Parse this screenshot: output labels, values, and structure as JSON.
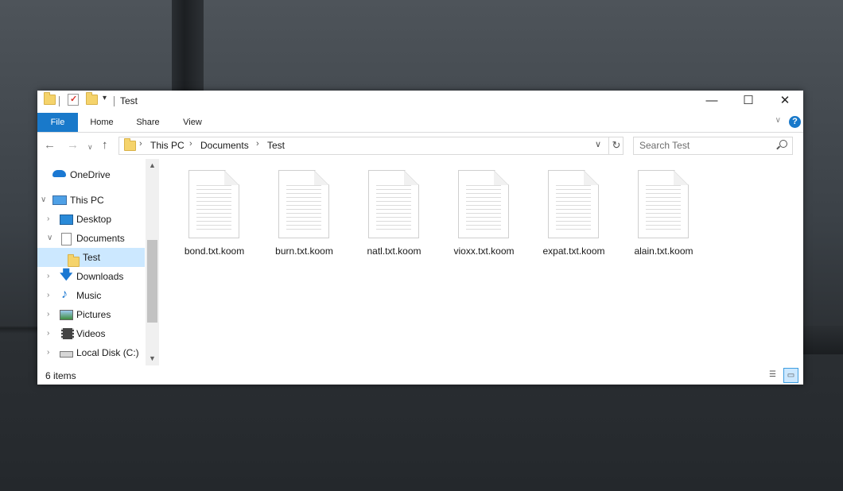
{
  "window": {
    "title": "Test",
    "controls": {
      "minimize": "—",
      "maximize": "☐",
      "close": "✕"
    }
  },
  "ribbon": {
    "tabs": [
      "File",
      "Home",
      "Share",
      "View"
    ],
    "help": "?"
  },
  "address": {
    "crumbs": [
      "This PC",
      "Documents",
      "Test"
    ]
  },
  "search": {
    "placeholder": "Search Test"
  },
  "nav": {
    "items": [
      {
        "label": "OneDrive",
        "icon": "cloud-icon"
      },
      {
        "label": "This PC",
        "icon": "computer-icon"
      },
      {
        "label": "Desktop",
        "icon": "desktop-icon"
      },
      {
        "label": "Documents",
        "icon": "documents-icon"
      },
      {
        "label": "Test",
        "icon": "folder-icon",
        "selected": true
      },
      {
        "label": "Downloads",
        "icon": "downloads-icon"
      },
      {
        "label": "Music",
        "icon": "music-icon"
      },
      {
        "label": "Pictures",
        "icon": "pictures-icon"
      },
      {
        "label": "Videos",
        "icon": "videos-icon"
      },
      {
        "label": "Local Disk (C:)",
        "icon": "disk-icon"
      }
    ]
  },
  "files": [
    {
      "name": "bond.txt.koom"
    },
    {
      "name": "burn.txt.koom"
    },
    {
      "name": "natl.txt.koom"
    },
    {
      "name": "vioxx.txt.koom"
    },
    {
      "name": "expat.txt.koom"
    },
    {
      "name": "alain.txt.koom"
    }
  ],
  "status": {
    "count": "6 items"
  },
  "colors": {
    "accent": "#1979ca",
    "selection": "#cce8ff"
  }
}
